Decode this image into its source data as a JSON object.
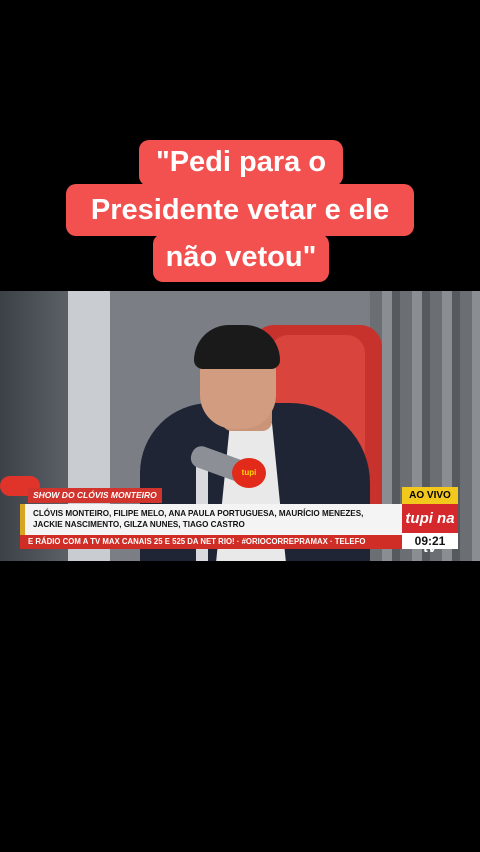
{
  "caption": {
    "line1": "\"Pedi para o",
    "line2": "Presidente vetar e ele",
    "line3": "não vetou\""
  },
  "broadcast": {
    "program_title": "SHOW DO CLÓVIS MONTEIRO",
    "names_line1": "CLÓVIS MONTEIRO, FILIPE MELO, ANA PAULA PORTUGUESA, MAURÍCIO MENEZES,",
    "names_line2": "JACKIE NASCIMENTO, GILZA NUNES, TIAGO CASTRO",
    "ticker": "E RÁDIO COM A TV MAX CANAIS 25 E 525 DA NET RIO! · #ORIOCORREPRAMAX · TELEFO",
    "live_badge": "AO VIVO",
    "channel_logo": "tupi na tv",
    "clock": "09:21",
    "mic_flag_text": "tupi"
  },
  "colors": {
    "caption_bg": "#f2514f",
    "ticker_red": "#cf2d25",
    "live_yellow": "#f3c81c"
  }
}
